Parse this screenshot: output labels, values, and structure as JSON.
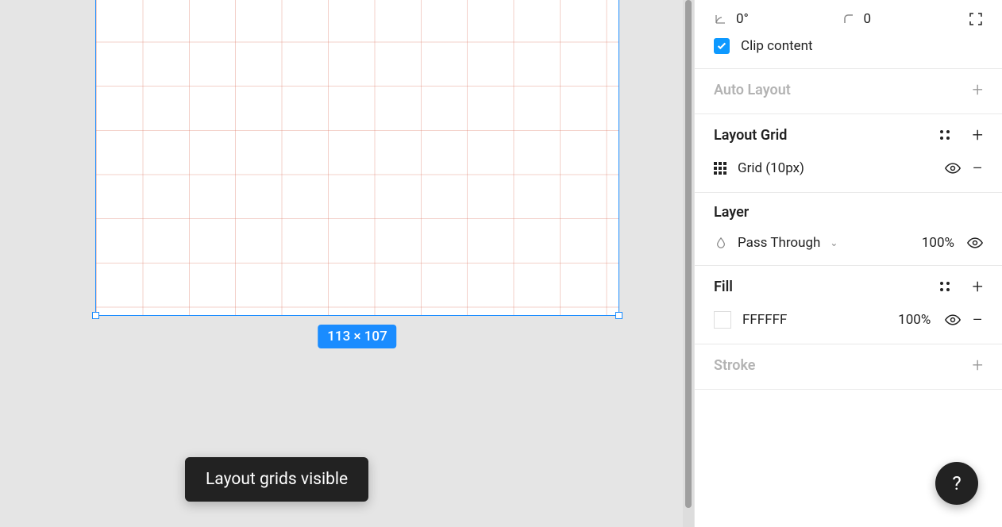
{
  "transform": {
    "rotation": "0°",
    "corner_radius": "0",
    "clip_content_label": "Clip content",
    "clip_content_checked": true
  },
  "auto_layout": {
    "title": "Auto Layout"
  },
  "layout_grid": {
    "title": "Layout Grid",
    "item_label": "Grid (10px)"
  },
  "layer": {
    "title": "Layer",
    "blend_mode": "Pass Through",
    "opacity": "100%"
  },
  "fill": {
    "title": "Fill",
    "hex": "FFFFFF",
    "opacity": "100%"
  },
  "stroke": {
    "title": "Stroke"
  },
  "canvas": {
    "dimensions": "113 × 107"
  },
  "toast": {
    "message": "Layout grids visible"
  },
  "help": {
    "label": "?"
  }
}
